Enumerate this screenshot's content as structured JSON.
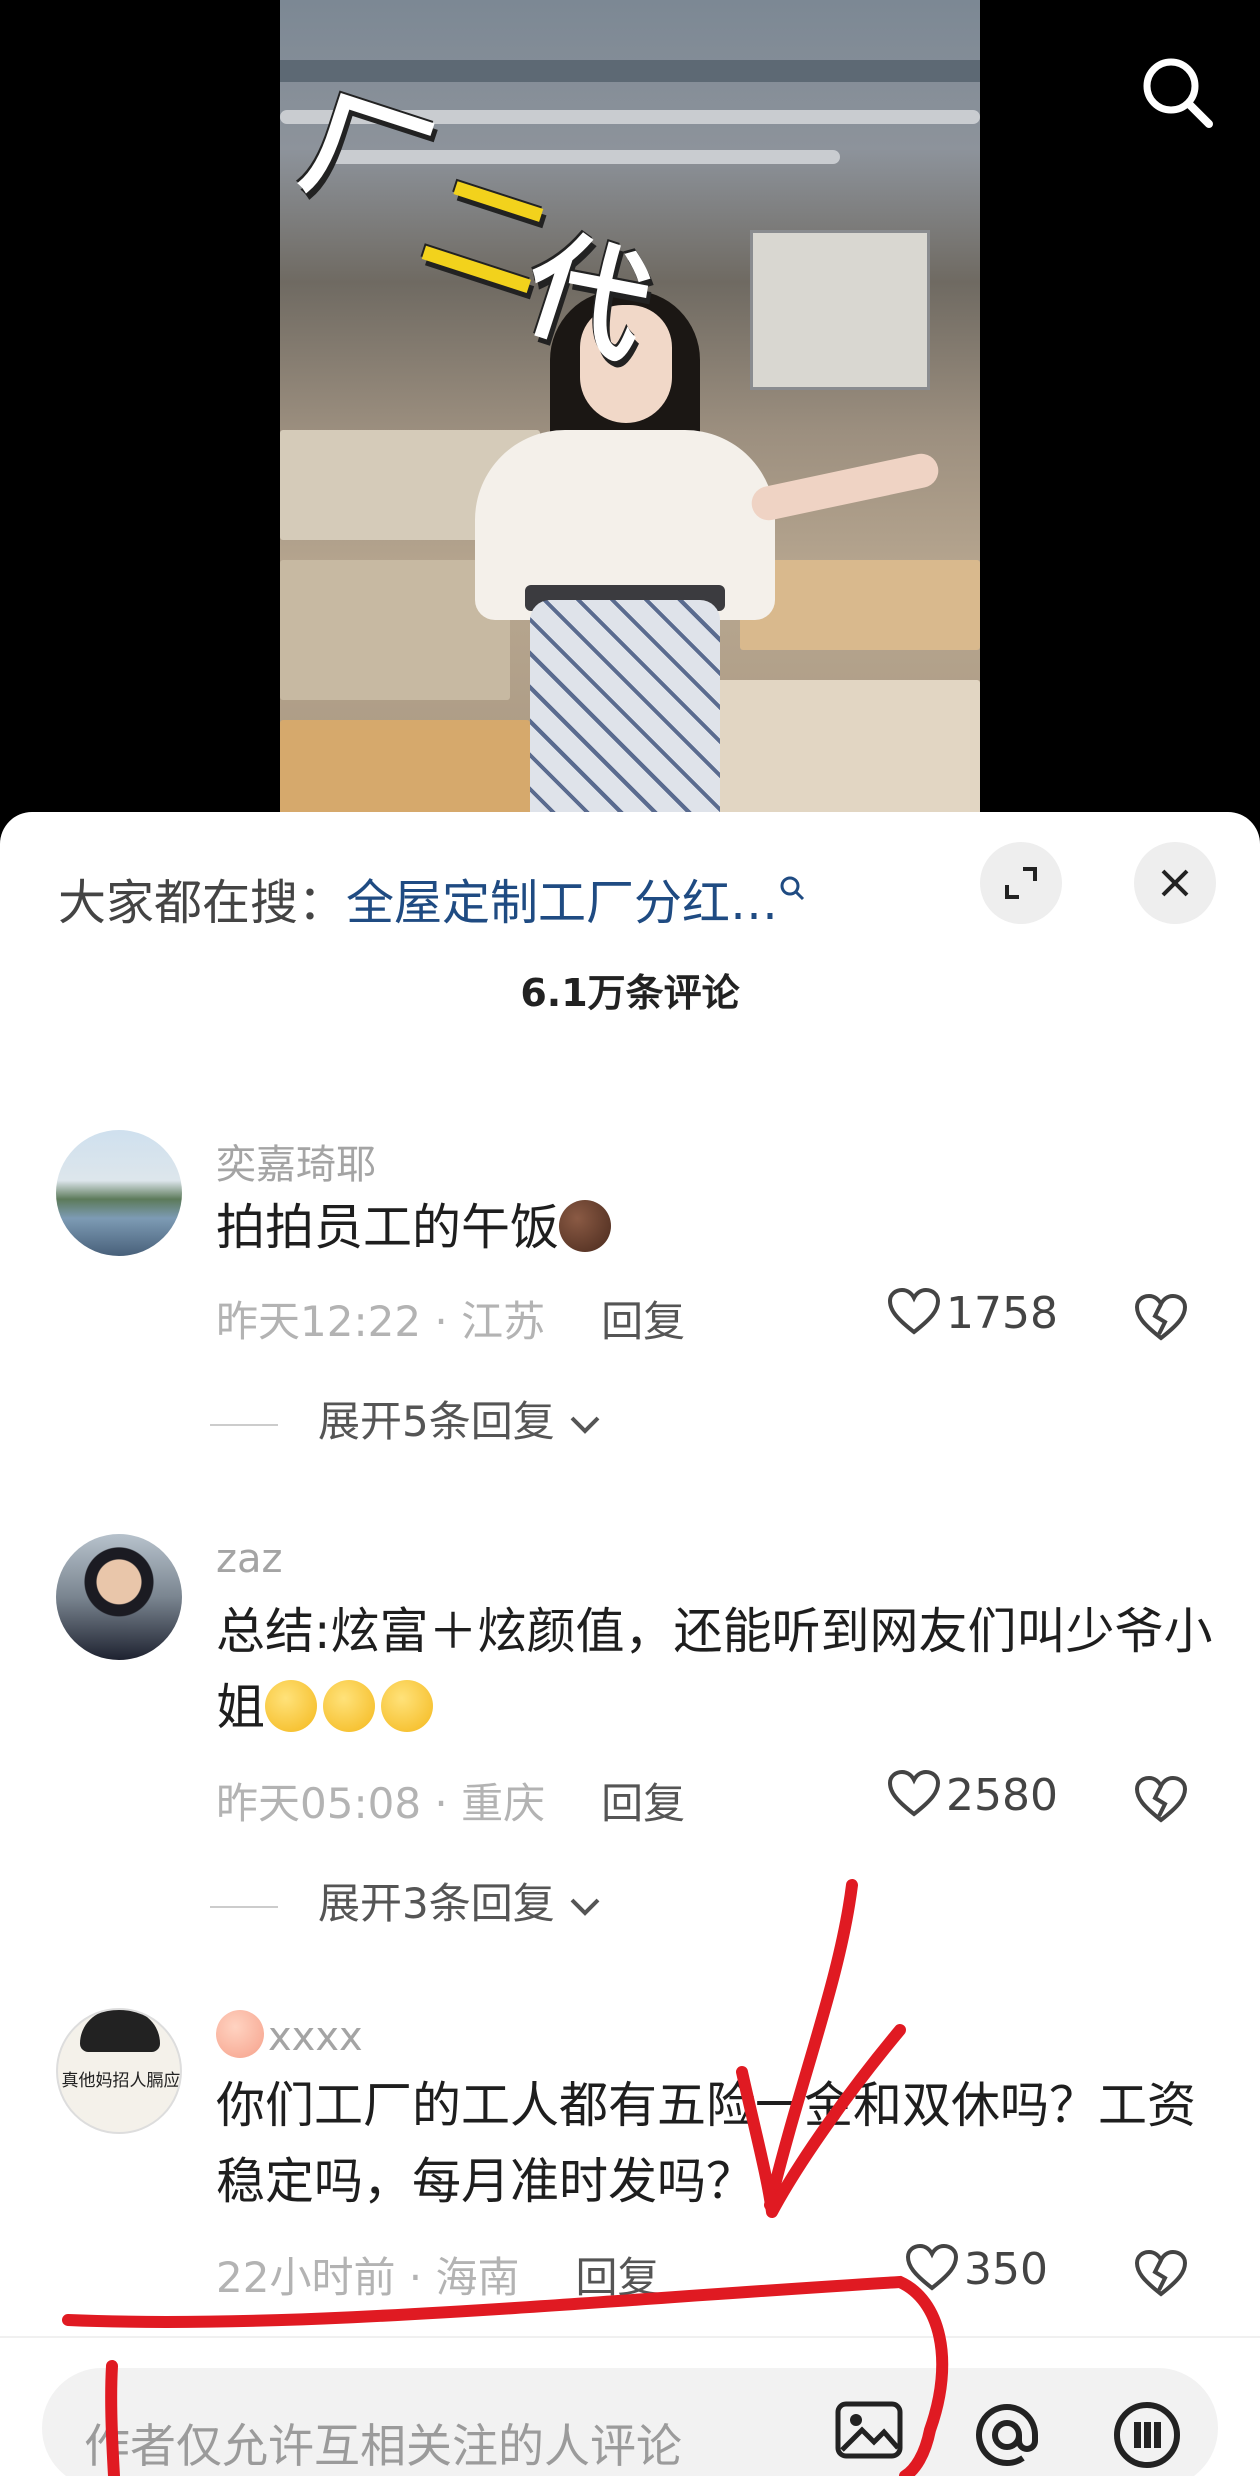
{
  "video": {
    "overlay_text": [
      "厂",
      "二",
      "代"
    ],
    "search_icon": "search-icon"
  },
  "sheet": {
    "search_prefix": "大家都在搜：",
    "search_term": "全屋定制工厂分红…",
    "comment_count": "6.1万条评论",
    "icons": [
      "expand-icon",
      "close-icon"
    ]
  },
  "comments": [
    {
      "username": "奕嘉琦耶",
      "text": "拍拍员工的午饭",
      "time": "昨天12:22",
      "location": "江苏",
      "reply_label": "回复",
      "likes": "1758",
      "expand_label": "展开5条回复"
    },
    {
      "username": "zaz",
      "text": "总结:炫富＋炫颜值，还能听到网友们叫少爷小姐",
      "time": "昨天05:08",
      "location": "重庆",
      "reply_label": "回复",
      "likes": "2580",
      "expand_label": "展开3条回复"
    },
    {
      "username": "xxxx",
      "avatar_text": "真他妈招人膈应",
      "text": "你们工厂的工人都有五险一金和双休吗？工资稳定吗，每月准时发吗？",
      "time": "22小时前",
      "location": "海南",
      "reply_label": "回复",
      "likes": "350"
    }
  ],
  "input": {
    "placeholder": "作者仅允许互相关注的人评论",
    "icons": [
      "image-icon",
      "at-icon",
      "emoji-icon"
    ]
  },
  "colors": {
    "search_term": "#1f4b82",
    "annotation_red": "#e01a22"
  }
}
